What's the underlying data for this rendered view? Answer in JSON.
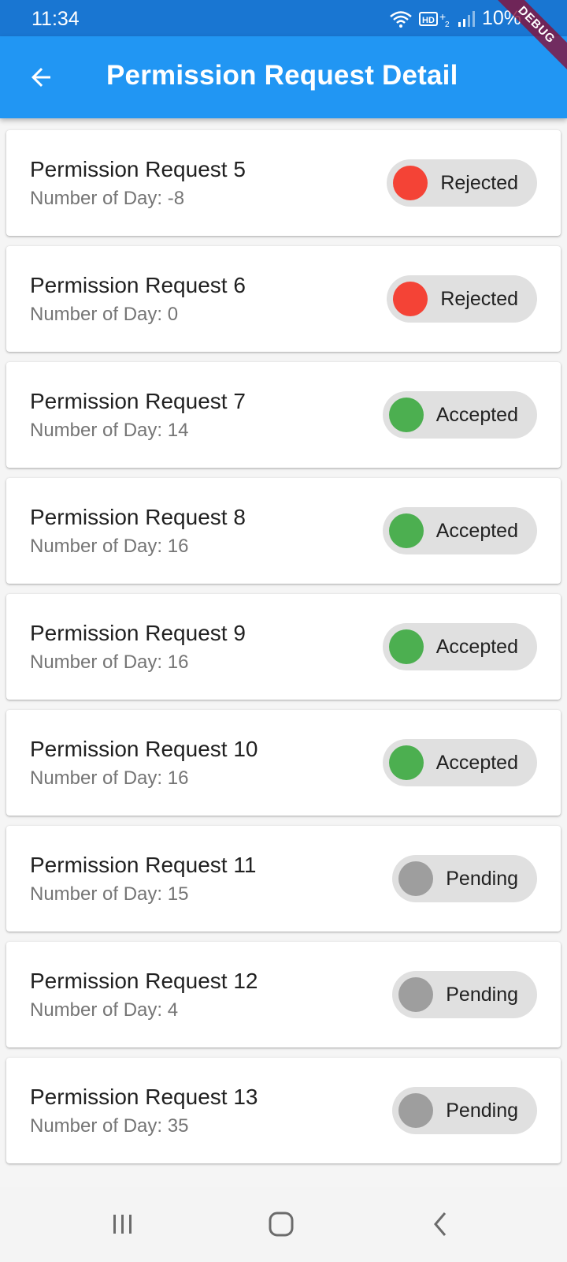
{
  "status_bar": {
    "time": "11:34",
    "battery": "10%"
  },
  "app_bar": {
    "title": "Permission Request Detail"
  },
  "debug_banner": "DEBUG",
  "colors": {
    "status_bar": "#1976d2",
    "app_bar": "#2196f3",
    "rejected": "#f44336",
    "accepted": "#4caf50",
    "pending": "#9e9e9e",
    "chip_bg": "#e0e0e0"
  },
  "requests": [
    {
      "title": "Permission Request 5",
      "subtitle": "Number of Day: -8",
      "status": "Rejected"
    },
    {
      "title": "Permission Request 6",
      "subtitle": "Number of Day: 0",
      "status": "Rejected"
    },
    {
      "title": "Permission Request 7",
      "subtitle": "Number of Day: 14",
      "status": "Accepted"
    },
    {
      "title": "Permission Request 8",
      "subtitle": "Number of Day: 16",
      "status": "Accepted"
    },
    {
      "title": "Permission Request 9",
      "subtitle": "Number of Day: 16",
      "status": "Accepted"
    },
    {
      "title": "Permission Request 10",
      "subtitle": "Number of Day: 16",
      "status": "Accepted"
    },
    {
      "title": "Permission Request 11",
      "subtitle": "Number of Day: 15",
      "status": "Pending"
    },
    {
      "title": "Permission Request 12",
      "subtitle": "Number of Day: 4",
      "status": "Pending"
    },
    {
      "title": "Permission Request 13",
      "subtitle": "Number of Day: 35",
      "status": "Pending"
    }
  ],
  "icons": {
    "back": "arrow-back-icon",
    "nav_recents": "recents-icon",
    "nav_home": "home-icon",
    "nav_back": "nav-back-icon"
  }
}
